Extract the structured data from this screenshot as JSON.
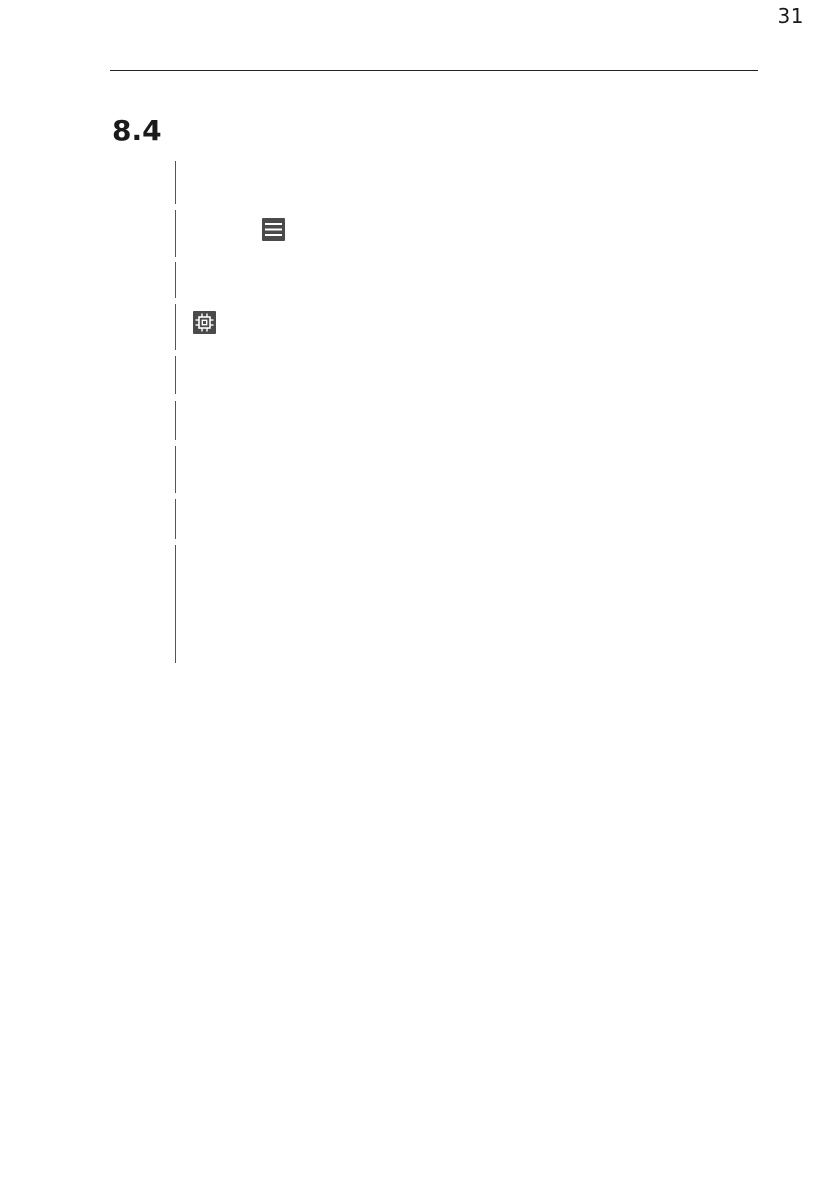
{
  "header": {
    "page_number": "31"
  },
  "section": {
    "number": "8.4"
  },
  "icons": {
    "menu": "menu-icon",
    "chip": "chip-icon"
  },
  "colors": {
    "icon_background": "#4a4a4a",
    "icon_foreground": "#ffffff",
    "rule": "#222222"
  }
}
